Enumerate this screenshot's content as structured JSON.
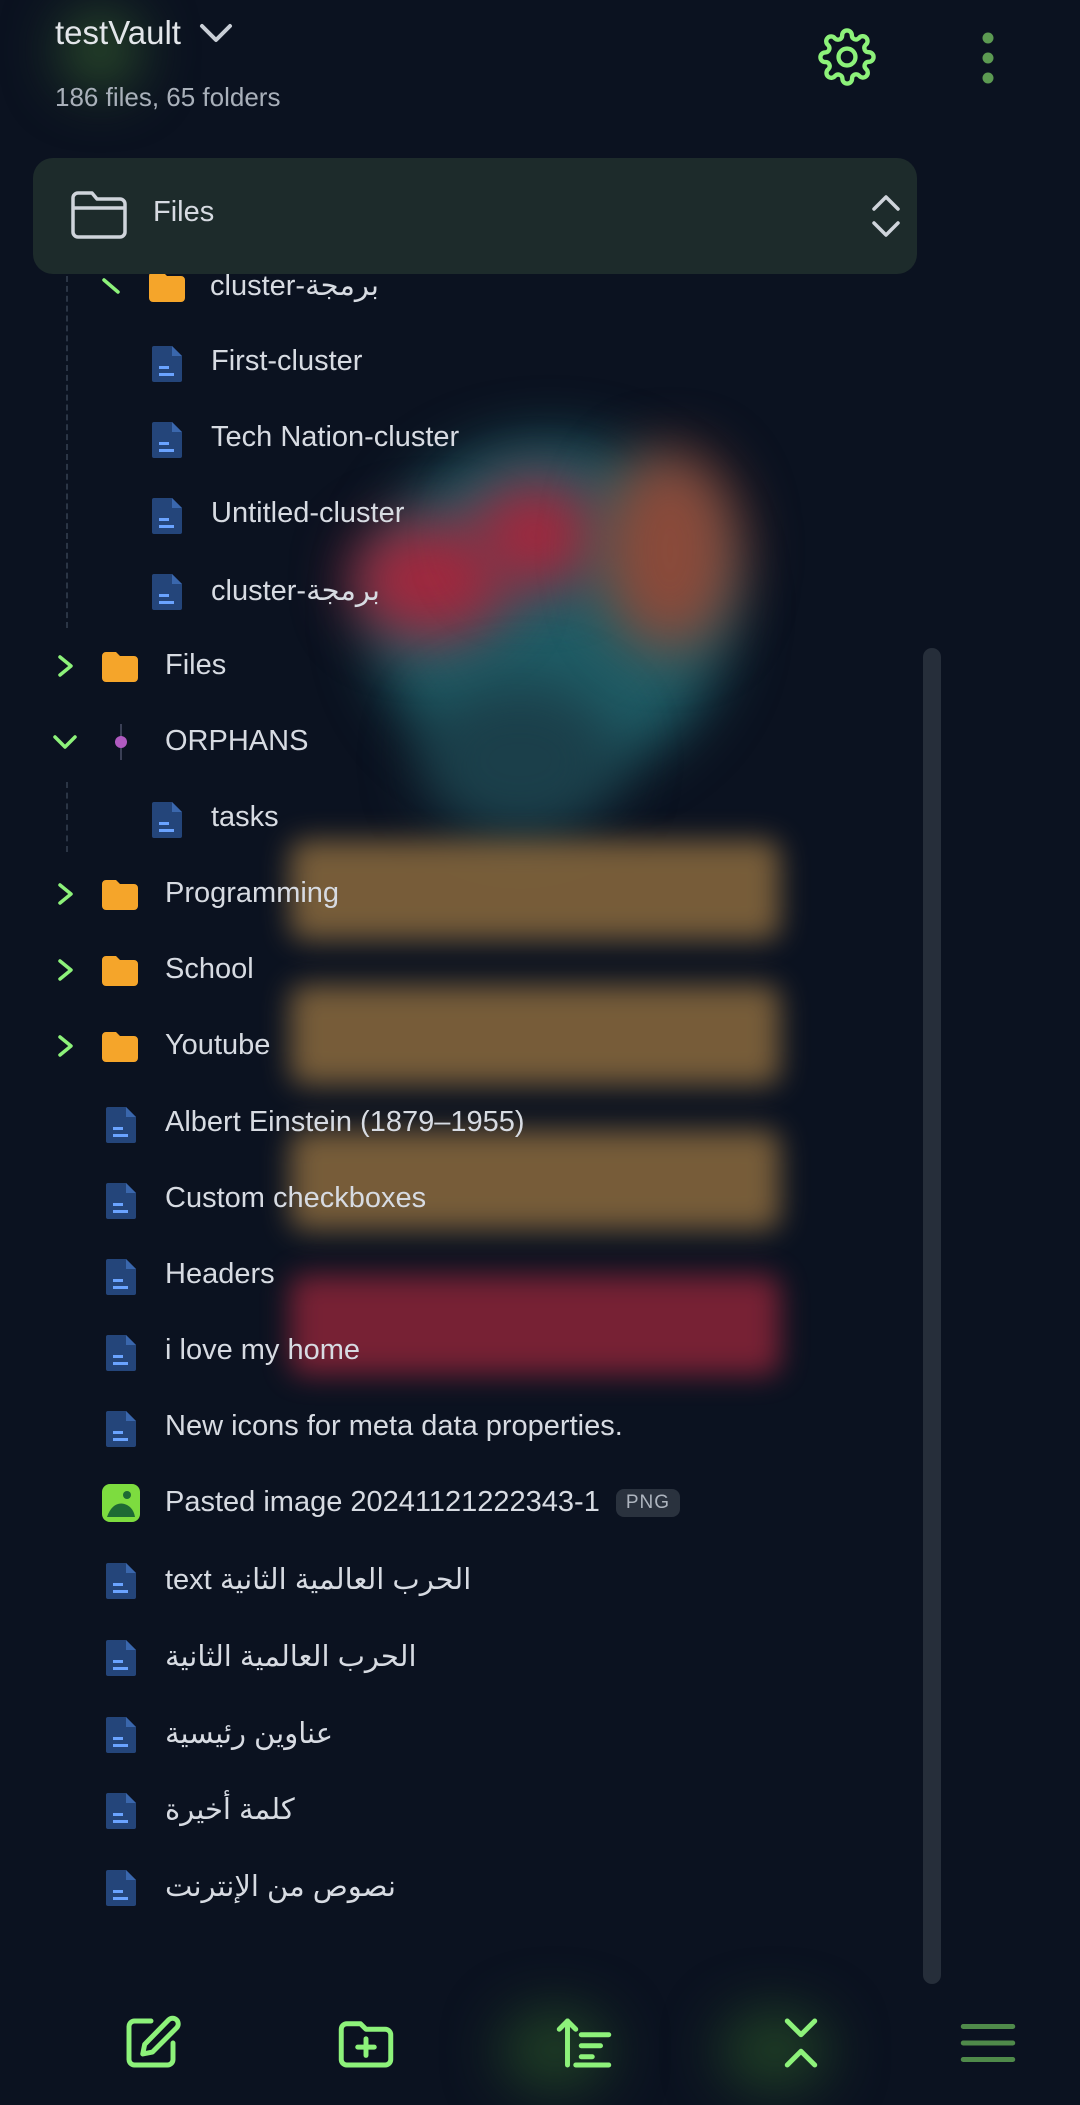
{
  "header": {
    "vault_name": "testVault",
    "stats": "186 files, 65 folders"
  },
  "selector": {
    "label": "Files"
  },
  "tree": {
    "partial_top_folder": "cluster-برمجة",
    "nested_cluster_files": [
      "First-cluster",
      "Tech Nation-cluster",
      "Untitled-cluster",
      "cluster-برمجة"
    ],
    "files_folder": "Files",
    "orphans_folder": "ORPHANS",
    "orphans_children": [
      "tasks"
    ],
    "folders": [
      "Programming",
      "School",
      "Youtube"
    ],
    "root_files": [
      "Albert Einstein (1879–1955)",
      "Custom checkboxes",
      "Headers",
      "i love my home",
      "New icons for meta data properties.",
      "Pasted image 20241121222343-1",
      "text الحرب العالمية الثانية",
      "الحرب العالمية الثانية",
      "عناوين رئيسية",
      "كلمة أخيرة",
      "نصوص من الإنترنت"
    ],
    "png_badge": "PNG"
  },
  "colors": {
    "accent": "#8df27a",
    "folder": "#f5a52a",
    "file_icon": "#24457a",
    "orphan_dot": "#b05ac0"
  },
  "toolbar": {
    "icons": [
      "new-note-icon",
      "new-folder-icon",
      "sort-icon",
      "collapse-all-icon",
      "menu-icon"
    ]
  }
}
